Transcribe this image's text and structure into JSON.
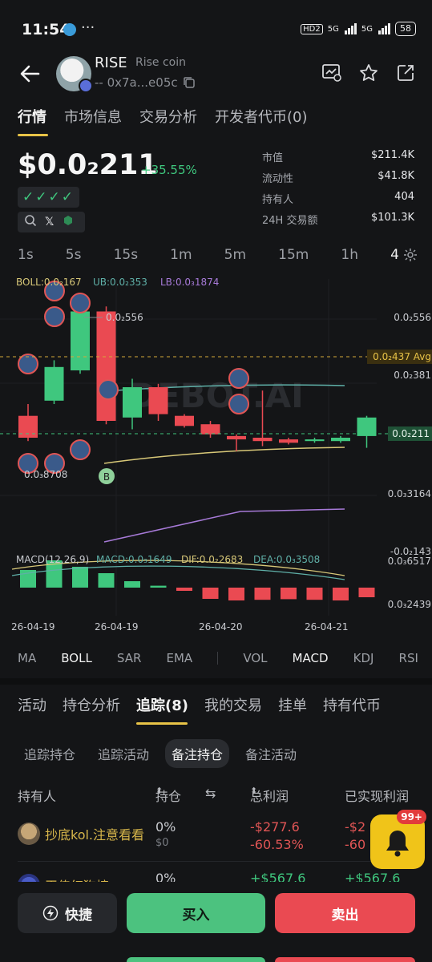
{
  "status_bar": {
    "time": "11:54",
    "dots": "···",
    "hd": "HD2",
    "net1": "5G",
    "net2": "5G",
    "battery": "58"
  },
  "header": {
    "token_symbol": "RISE",
    "token_name": "Rise coin",
    "address": "-- 0x7a...e05c"
  },
  "main_tabs": [
    "行情",
    "市场信息",
    "交易分析",
    "开发者代币(0)"
  ],
  "price": {
    "value": "$0.0₂211",
    "change": "+35.55%",
    "checks": "✓✓✓✓"
  },
  "stats": [
    {
      "label": "市值",
      "value": "$211.4K"
    },
    {
      "label": "流动性",
      "value": "$41.8K"
    },
    {
      "label": "持有人",
      "value": "404"
    },
    {
      "label": "24H 交易额",
      "value": "$101.3K"
    }
  ],
  "intervals": [
    "1s",
    "5s",
    "15s",
    "1m",
    "5m",
    "15m",
    "1h",
    "4"
  ],
  "chart_data": {
    "type": "candlestick",
    "indicator_top": {
      "boll": "BOLL:0.0₂167",
      "ub": "UB:0.0₂353",
      "lb": "LB:0.0₃1874"
    },
    "price_labels": [
      "0.0₂556",
      "0.0₂437 Avg",
      "0.0₂381",
      "0.0₂211",
      "0.0₃3164",
      "-0.0₂143"
    ],
    "high_marker": "0.0₂556",
    "low_marker": "0.0₃8708",
    "watermark": "DEBOT.AI",
    "buy_marker": "B",
    "macd_labels": {
      "macd": "MACD(12,26,9)",
      "val": "MACD:0.0₃1649",
      "dif": "DIF:0.0₂2683",
      "dea": "DEA:0.0₃3508"
    },
    "macd_axis": [
      "0.0₃6517",
      "0.0₃2439"
    ],
    "x_labels": [
      "26-04-19",
      "26-04-19",
      "26-04-20",
      "26-04-21"
    ],
    "candles": [
      {
        "o": 0.33,
        "c": 0.2,
        "h": 0.4,
        "l": 0.18
      },
      {
        "o": 0.42,
        "c": 0.62,
        "h": 0.66,
        "l": 0.4
      },
      {
        "o": 0.6,
        "c": 0.95,
        "h": 1.0,
        "l": 0.58
      },
      {
        "o": 0.95,
        "c": 0.3,
        "h": 0.98,
        "l": 0.28
      },
      {
        "o": 0.32,
        "c": 0.5,
        "h": 0.55,
        "l": 0.25
      },
      {
        "o": 0.5,
        "c": 0.34,
        "h": 0.52,
        "l": 0.3
      },
      {
        "o": 0.33,
        "c": 0.27,
        "h": 0.34,
        "l": 0.26
      },
      {
        "o": 0.28,
        "c": 0.22,
        "h": 0.3,
        "l": 0.2
      },
      {
        "o": 0.21,
        "c": 0.19,
        "h": 0.22,
        "l": 0.12
      },
      {
        "o": 0.2,
        "c": 0.18,
        "h": 0.48,
        "l": 0.15
      },
      {
        "o": 0.19,
        "c": 0.17,
        "h": 0.2,
        "l": 0.16
      },
      {
        "o": 0.18,
        "c": 0.19,
        "h": 0.2,
        "l": 0.17
      },
      {
        "o": 0.18,
        "c": 0.2,
        "h": 0.21,
        "l": 0.17
      },
      {
        "o": 0.21,
        "c": 0.32,
        "h": 0.33,
        "l": 0.14
      }
    ],
    "macd_bars": [
      0.55,
      0.85,
      0.65,
      0.45,
      0.2,
      0.06,
      -0.1,
      -0.35,
      -0.4,
      -0.38,
      -0.36,
      -0.38,
      -0.4,
      -0.3
    ]
  },
  "indicators": [
    "MA",
    "BOLL",
    "SAR",
    "EMA",
    "VOL",
    "MACD",
    "KDJ",
    "RSI"
  ],
  "section_tabs": [
    "活动",
    "持仓分析",
    "追踪(8)",
    "我的交易",
    "挂单",
    "持有代币"
  ],
  "sub_tabs": [
    "追踪持仓",
    "追踪活动",
    "备注持仓",
    "备注活动"
  ],
  "table": {
    "headers": [
      "持有人",
      "持仓",
      "总利润",
      "已实现利润"
    ],
    "rows": [
      {
        "name": "抄底kol.注意看看",
        "pos": "0%",
        "pos2": "$0",
        "pl1": "-$277.6",
        "pl2": "-60.53%",
        "rl1": "-$2",
        "rl2": "-60"
      },
      {
        "name": "王传红狗榜",
        "pos": "0%",
        "pos2": "",
        "pl1": "+$567.6",
        "pl2": "",
        "rl1": "+$567.6",
        "rl2": ""
      }
    ]
  },
  "bell": {
    "badge": "99+"
  },
  "buttons": {
    "quick": "快捷",
    "buy": "买入",
    "sell": "出"
  },
  "colors": {
    "up": "#3fc77e",
    "down": "#ea4a52",
    "accent": "#e8c347"
  }
}
